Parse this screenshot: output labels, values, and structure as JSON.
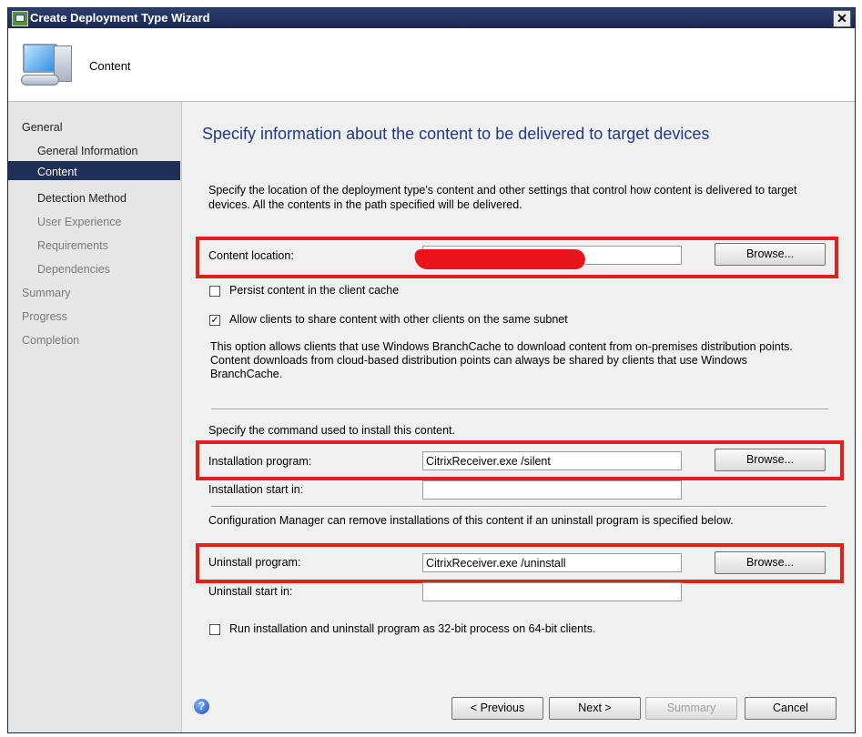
{
  "window": {
    "title": "Create Deployment Type Wizard",
    "close_glyph": "✕"
  },
  "header": {
    "title": "Content",
    "icon": "computer-icon"
  },
  "nav": {
    "items": [
      {
        "label": "General"
      },
      {
        "label": "General Information"
      },
      {
        "label": "Content"
      },
      {
        "label": "Detection Method"
      },
      {
        "label": "User Experience"
      },
      {
        "label": "Requirements"
      },
      {
        "label": "Dependencies"
      },
      {
        "label": "Summary"
      },
      {
        "label": "Progress"
      },
      {
        "label": "Completion"
      }
    ],
    "selected": "Content"
  },
  "page": {
    "heading": "Specify information about the content to be delivered to target devices",
    "intro_line1": "Specify the location of the deployment type's content and other settings that control how content is delivered to target",
    "intro_line2": "devices. All the contents in the path specified will be delivered.",
    "content_location_label": "Content location:",
    "content_location_value": "",
    "browse_label": "Browse...",
    "persist_label": "Persist content in the client cache",
    "persist_checked": false,
    "allow_share_label": "Allow clients to share content with other clients on the same subnet",
    "allow_share_checked": true,
    "branchcache_line1": "This option allows clients that use Windows BranchCache to download content from on-premises distribution points.",
    "branchcache_line2": "Content downloads from cloud-based distribution points can always be shared by clients that use Windows",
    "branchcache_line3": "BranchCache.",
    "install_command_text": "Specify the command used to install this content.",
    "install_program_label": "Installation program:",
    "install_program_value": "CitrixReceiver.exe /silent",
    "install_start_label": "Installation start in:",
    "install_start_value": "",
    "uninstall_note": "Configuration Manager can remove installations of this content if an uninstall program is specified below.",
    "uninstall_program_label": "Uninstall program:",
    "uninstall_program_value": "CitrixReceiver.exe /uninstall",
    "uninstall_start_label": "Uninstall start in:",
    "uninstall_start_value": "",
    "run32_label": "Run installation and uninstall program as 32-bit process on 64-bit clients.",
    "run32_checked": false
  },
  "footer": {
    "help_glyph": "?",
    "previous_label": "< Previous",
    "next_label": "Next >",
    "summary_label": "Summary",
    "cancel_label": "Cancel"
  },
  "colors": {
    "annotation": "#e0201c",
    "heading": "#1f3a8a",
    "nav_selected": "#1f2f57"
  }
}
